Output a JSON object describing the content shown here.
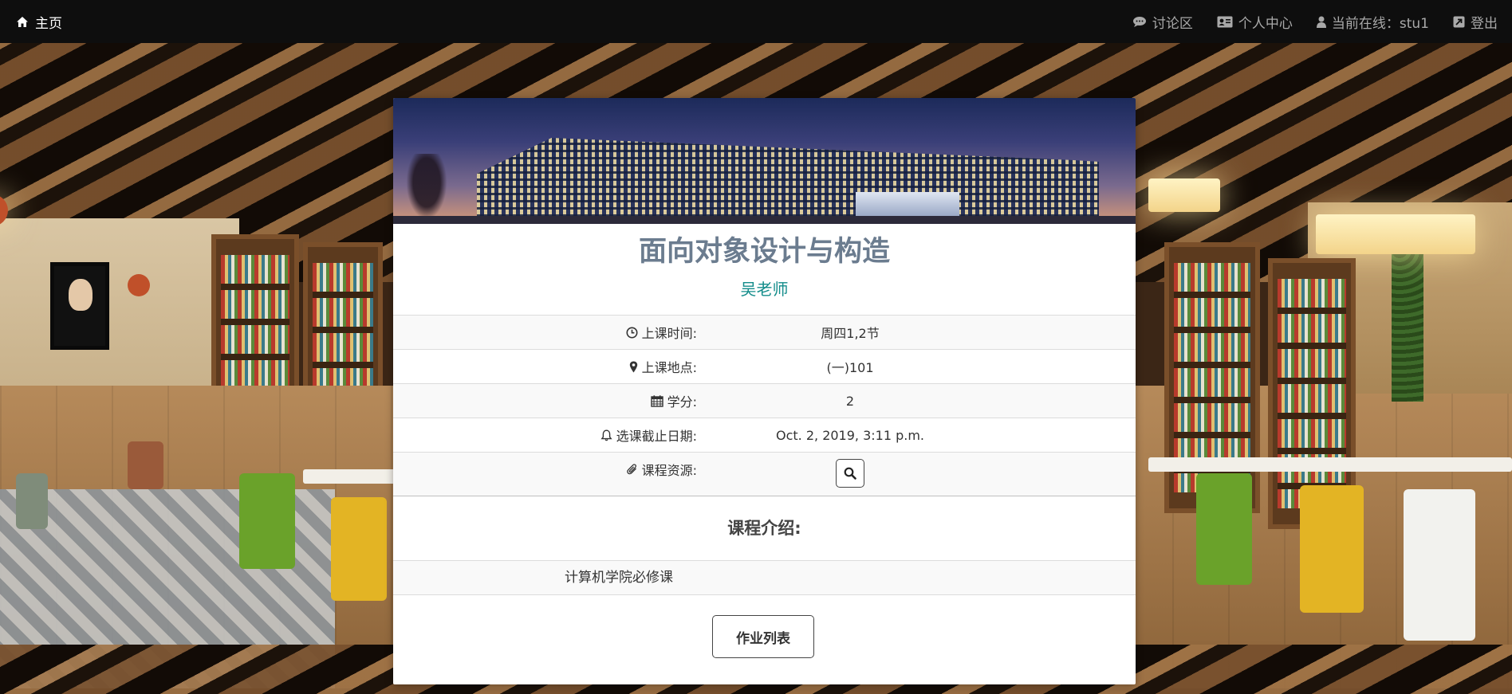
{
  "navbar": {
    "home_label": "主页",
    "forum_label": "讨论区",
    "profile_label": "个人中心",
    "online_label": "当前在线：stu1",
    "logout_label": "登出"
  },
  "course": {
    "title": "面向对象设计与构造",
    "teacher": "吴老师",
    "rows": [
      {
        "label": "上课时间:",
        "value": "周四1,2节"
      },
      {
        "label": "上课地点:",
        "value": "(一)101"
      },
      {
        "label": "学分:",
        "value": "2"
      },
      {
        "label": "选课截止日期:",
        "value": "Oct. 2, 2019, 3:11 p.m."
      },
      {
        "label": "课程资源:"
      }
    ],
    "intro_heading": "课程介绍:",
    "intro_text": "计算机学院必修课",
    "homework_button": "作业列表"
  },
  "colors": {
    "navbar_bg": "#0e0e0e",
    "title": "#6b7c8f",
    "teacher": "#128c8a"
  },
  "icons": [
    "home-icon",
    "comment-icon",
    "id-card-icon",
    "user-icon",
    "logout-icon",
    "clock-icon",
    "map-marker-icon",
    "calendar-icon",
    "bell-icon",
    "paperclip-icon",
    "search-icon"
  ]
}
